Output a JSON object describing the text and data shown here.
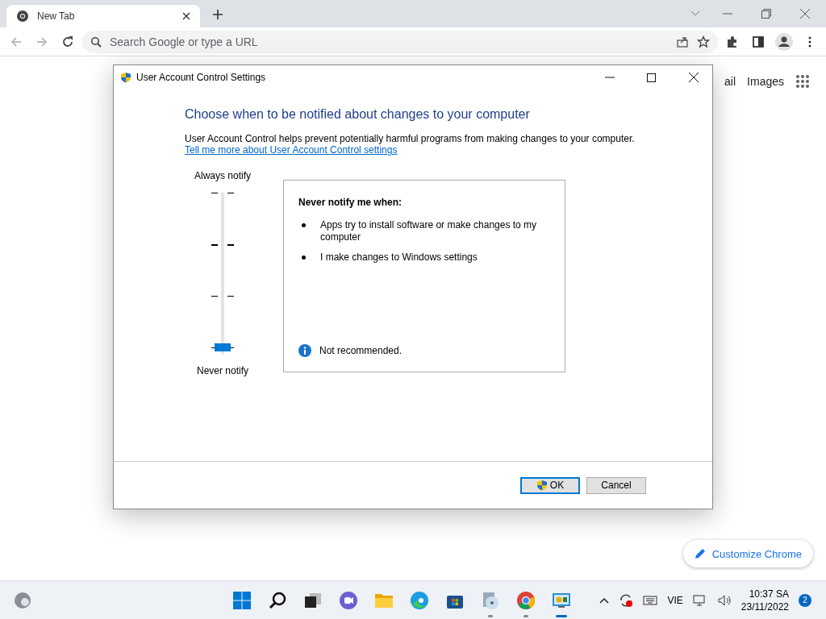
{
  "browser": {
    "tabs": [
      {
        "label": "New Tab",
        "selected": true
      }
    ],
    "address": {
      "placeholder": "Search Google or type a URL"
    },
    "page_links": [
      "ail",
      "Images"
    ],
    "customize_button": "Customize Chrome"
  },
  "dialog": {
    "title": "User Account Control Settings",
    "heading": "Choose when to be notified about changes to your computer",
    "description": "User Account Control helps prevent potentially harmful programs from making changes to your computer.",
    "link": "Tell me more about User Account Control settings",
    "slider": {
      "top_label": "Always notify",
      "bottom_label": "Never notify",
      "level": 0
    },
    "info": {
      "title": "Never notify me when:",
      "bullets": [
        "Apps try to install software or make changes to my computer",
        "I make changes to Windows settings"
      ],
      "note": "Not recommended."
    },
    "buttons": [
      {
        "label": "OK",
        "kind": "shield"
      },
      {
        "label": "Cancel",
        "kind": "plain"
      }
    ]
  },
  "taskbar": {
    "apps": [
      {
        "kind": "start",
        "running": false
      },
      {
        "kind": "search",
        "running": false
      },
      {
        "kind": "taskview",
        "running": false
      },
      {
        "kind": "chat",
        "running": false
      },
      {
        "kind": "folder",
        "running": false
      },
      {
        "kind": "edge",
        "running": false
      },
      {
        "kind": "store",
        "running": false
      },
      {
        "kind": "media",
        "running": true
      },
      {
        "kind": "chrome",
        "running": true
      },
      {
        "kind": "control",
        "running": true
      }
    ],
    "language": "VIE",
    "time": "10:37 SA",
    "date": "23/11/2022",
    "notifications": "2"
  }
}
